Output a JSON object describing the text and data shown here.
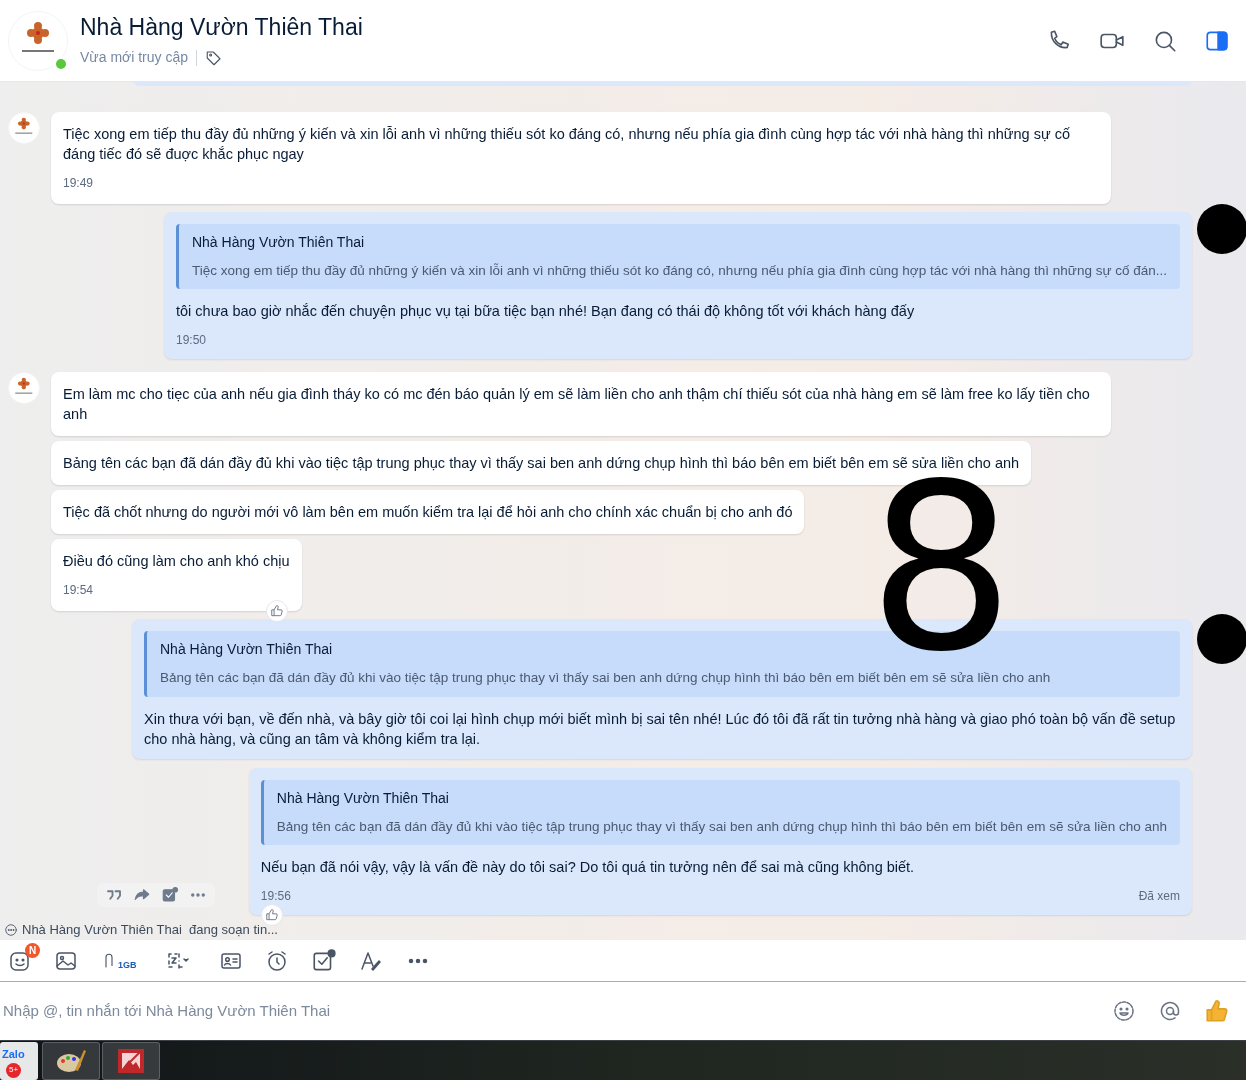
{
  "header": {
    "title": "Nhà Hàng Vườn Thiên Thai",
    "status": "Vừa mới truy cập",
    "online": true
  },
  "messages": [
    {
      "kind": "incoming",
      "avatar": true,
      "text": "Tiệc xong em tiếp thu đầy đủ những ý kiến và xin lỗi anh vì những thiếu sót ko đáng có, nhưng nếu phía gia đình cùng hợp tác với nhà hàng thì những sự cố đáng tiếc đó sẽ đuợc khắc phục ngay",
      "time": "19:49"
    },
    {
      "kind": "outgoing",
      "quote_author": "Nhà Hàng Vườn Thiên Thai",
      "quote_text": "Tiệc xong em tiếp thu đầy đủ những ý kiến và xin lỗi anh vì những thiếu sót ko đáng có, nhưng nếu phía gia đình cùng hợp tác với nhà hàng thì những sự cố đán...",
      "text": "tôi chưa bao giờ nhắc đến chuyện phục vụ tại bữa tiệc bạn nhé! Bạn đang có thái độ không tốt với khách hàng đấy",
      "time": "19:50"
    },
    {
      "kind": "incoming",
      "avatar": true,
      "text": "Em làm mc cho tiẹc của anh nếu gia đình tháy ko có mc đén báo quản lý em sẽ làm liền cho anh thậm chí thiếu sót của nhà hàng em sẽ làm free ko lấy tiền cho anh"
    },
    {
      "kind": "incoming",
      "avatar": false,
      "text": "Bảng tên các bạn đã dán đầy đủ khi vào tiệc tập trung phục thay vì thấy sai ben anh dứng chụp hình thì báo bên em biết bên em sẽ sửa liền cho anh"
    },
    {
      "kind": "incoming",
      "avatar": false,
      "text": "Tiệc đã chốt nhưng do người mới vô làm bên em muốn kiểm tra lại để hỏi anh cho chính xác chuẩn bị cho anh đó"
    },
    {
      "kind": "incoming",
      "avatar": false,
      "text": "Điều đó cũng làm cho anh khó chịu",
      "time": "19:54",
      "reaction": true
    },
    {
      "kind": "outgoing",
      "quote_author": "Nhà Hàng Vườn Thiên Thai",
      "quote_text": "Bảng tên các bạn đã dán đầy đủ khi vào tiệc tập trung phục thay vì thấy sai ben anh dứng chụp hình thì báo bên em biết bên em sẽ sửa liền cho anh",
      "text": "Xin thưa với bạn, về đến nhà, và bây giờ tôi coi lại hình chụp mới biết mình bị sai tên nhé! Lúc đó tôi đã rất tin tưởng nhà hàng và giao phó toàn bộ vấn đề setup cho nhà hàng, và cũng an tâm và không kiểm tra lại."
    },
    {
      "kind": "outgoing",
      "quote_author": "Nhà Hàng Vườn Thiên Thai",
      "quote_text": "Bảng tên các bạn đã dán đầy đủ khi vào tiệc tập trung phục thay vì thấy sai ben anh dứng chụp hình thì báo bên em biết bên em sẽ sửa liền cho anh",
      "text": "Nếu bạn đã nói vậy, vậy là vấn đề này do tôi sai? Do tôi quá tin tưởng nên để sai mà cũng không biết.",
      "time": "19:56",
      "seen": "Đã xem",
      "reaction": true,
      "hover_actions": true
    }
  ],
  "overlay_number": "8",
  "typing": "Nhà Hàng Vườn Thiên Thai  đang soạn tin...",
  "toolbar": {
    "sticker_badge": "N",
    "file_limit": "1GB"
  },
  "composer": {
    "placeholder": "Nhập @, tin nhắn tới Nhà Hàng Vườn Thiên Thai"
  },
  "taskbar": {
    "zalo_label": "Zalo",
    "zalo_badge": "5+"
  }
}
